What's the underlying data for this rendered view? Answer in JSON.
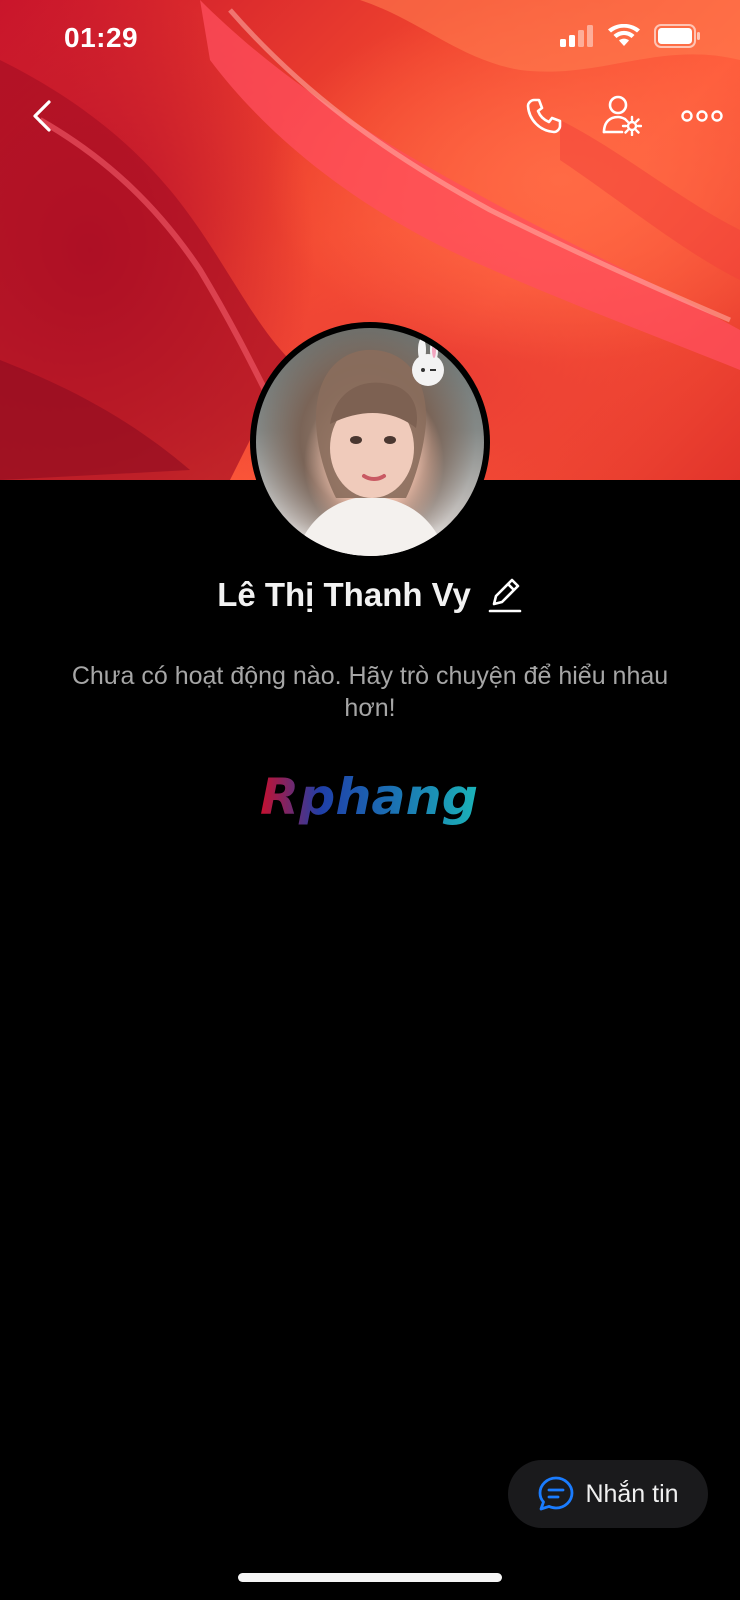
{
  "status_bar": {
    "time": "01:29",
    "signal_icon": "cellular-signal-icon",
    "wifi_icon": "wifi-icon",
    "battery_icon": "battery-icon"
  },
  "nav": {
    "back_icon": "chevron-left-icon",
    "call_icon": "phone-icon",
    "settings_icon": "user-settings-icon",
    "more_icon": "more-horizontal-icon"
  },
  "profile": {
    "name": "Lê Thị Thanh Vy",
    "edit_icon": "pencil-icon",
    "activity_text": "Chưa có hoạt động nào. Hãy trò chuyện để hiểu nhau hơn!",
    "watermark": "Rphang"
  },
  "actions": {
    "message_label": "Nhắn tin",
    "message_icon": "chat-bubble-icon"
  },
  "colors": {
    "background": "#000000",
    "accent_blue": "#1a7cff",
    "text_secondary": "#a6a6a6"
  }
}
